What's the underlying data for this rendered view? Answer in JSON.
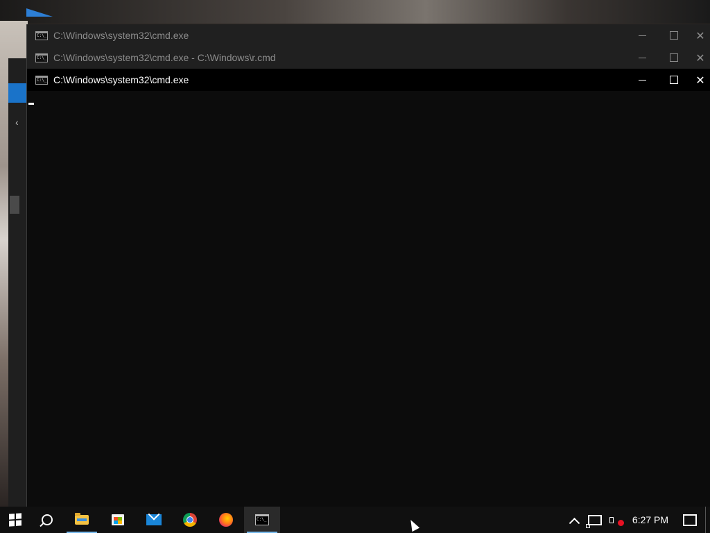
{
  "windows": [
    {
      "title": "C:\\Windows\\system32\\cmd.exe",
      "active": false,
      "icon": "cmd-icon"
    },
    {
      "title": "C:\\Windows\\system32\\cmd.exe - C:\\Windows\\r.cmd",
      "active": false,
      "icon": "cmd-icon"
    },
    {
      "title": "C:\\Windows\\system32\\cmd.exe",
      "active": true,
      "icon": "cmd-icon",
      "console_text": ""
    }
  ],
  "window_controls": {
    "minimize_icon": "minimize-icon",
    "maximize_icon": "maximize-icon",
    "close_icon": "close-icon",
    "close_glyph": "✕"
  },
  "taskbar": {
    "start_icon": "windows-start-icon",
    "search_icon": "search-icon",
    "pinned": [
      {
        "name": "File Explorer",
        "icon": "folder-icon",
        "open": true
      },
      {
        "name": "Microsoft Store",
        "icon": "store-icon",
        "open": false
      },
      {
        "name": "Mail",
        "icon": "mail-icon",
        "open": false
      },
      {
        "name": "Google Chrome",
        "icon": "chrome-icon",
        "open": false
      },
      {
        "name": "Firefox",
        "icon": "firefox-icon",
        "open": false
      },
      {
        "name": "Command Prompt",
        "icon": "terminal-icon",
        "open": true,
        "active": true
      }
    ],
    "tray": {
      "icons": [
        "chevron-up-icon",
        "network-icon",
        "volume-muted-icon"
      ],
      "clock": "6:27 PM",
      "notifications_icon": "notification-icon"
    }
  },
  "colors": {
    "taskbar_bg": "#101010",
    "active_indicator": "#76b9ed",
    "console_bg": "#0c0c0c",
    "inactive_title_text": "#8c8c8c",
    "active_title_text": "#ffffff"
  }
}
